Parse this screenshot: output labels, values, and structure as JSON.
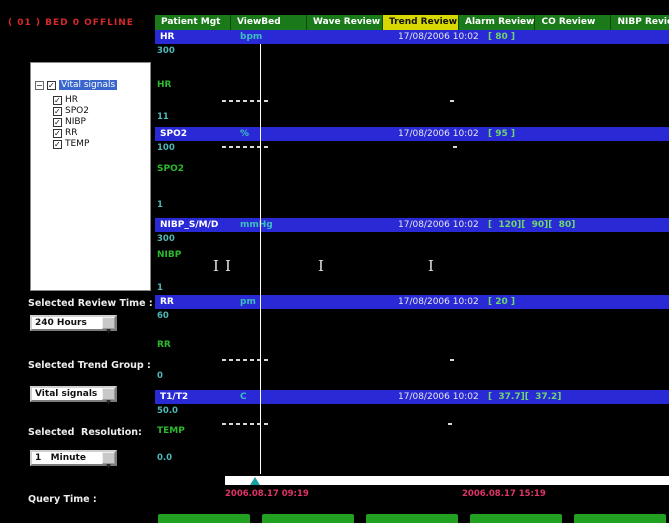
{
  "status_bar": {
    "text": "( 01 ) BED 0 OFFLINE"
  },
  "tabs": [
    {
      "label": "Patient Mgt"
    },
    {
      "label": "ViewBed"
    },
    {
      "label": "Wave Review"
    },
    {
      "label": "Trend Review",
      "active": true
    },
    {
      "label": "Alarm Review"
    },
    {
      "label": "CO Review"
    },
    {
      "label": "NIBP Review"
    }
  ],
  "tree": {
    "root_label": "Vital signals",
    "items": [
      {
        "label": "HR",
        "checked": true
      },
      {
        "label": "SPO2",
        "checked": true
      },
      {
        "label": "NIBP",
        "checked": true
      },
      {
        "label": "RR",
        "checked": true
      },
      {
        "label": "TEMP",
        "checked": true
      }
    ]
  },
  "controls": {
    "review_time": {
      "label": "Selected Review Time :",
      "value": "240 Hours"
    },
    "trend_group": {
      "label": "Selected Trend Group :",
      "value": "Vital signals"
    },
    "resolution": {
      "label": "Selected  Resolution:",
      "value": "1   Minute"
    },
    "query_time_label": "Query Time :"
  },
  "rows": [
    {
      "name": "HR",
      "unit": "bpm",
      "time": "17/08/2006 10:02",
      "values": "[ 80 ]",
      "scale_top": "300",
      "scale_bottom": "11",
      "trace_label": "HR"
    },
    {
      "name": "SPO2",
      "unit": "%",
      "time": "17/08/2006 10:02",
      "values": "[ 95 ]",
      "scale_top": "100",
      "scale_bottom": "1",
      "trace_label": "SPO2"
    },
    {
      "name": "NIBP_S/M/D",
      "unit": "mmHg",
      "time": "17/08/2006 10:02",
      "values": "[  120][  90][  80]",
      "scale_top": "300",
      "scale_bottom": "1",
      "trace_label": "NIBP"
    },
    {
      "name": "RR",
      "unit": "pm",
      "time": "17/08/2006 10:02",
      "values": "[ 20 ]",
      "scale_top": "60",
      "scale_bottom": "0",
      "trace_label": "RR"
    },
    {
      "name": "T1/T2",
      "unit": "C",
      "time": "17/08/2006 10:02",
      "values": "[  37.7][  37.2]",
      "scale_top": "50.0",
      "scale_bottom": "0.0",
      "trace_label": "TEMP"
    }
  ],
  "timeline": {
    "start_time": "2006.08.17 09:19",
    "end_time": "2006.08.17 15:19"
  },
  "icons": {
    "check": "✓",
    "dropdown_arrow": "▼",
    "expander_collapse": "−",
    "nibp_marker": "I"
  },
  "colors": {
    "header_bar": "#2929d6",
    "active_tab": "#d8d800",
    "tab_green": "#1a7a1a",
    "alarm_red": "#d42a2a",
    "label_green": "#2eb82e",
    "scale_cyan": "#4fb8b8",
    "query_time_pink": "#e03366"
  },
  "chart_data": {
    "type": "line",
    "cursor_time": "17/08/2006 10:02",
    "x_range": [
      "2006.08.17 09:19",
      "2006.08.17 15:19"
    ],
    "series": [
      {
        "name": "HR",
        "unit": "bpm",
        "value_at_cursor": 80,
        "ylim": [
          11,
          300
        ]
      },
      {
        "name": "SPO2",
        "unit": "%",
        "value_at_cursor": 95,
        "ylim": [
          1,
          100
        ]
      },
      {
        "name": "NIBP_S/M/D",
        "unit": "mmHg",
        "value_at_cursor": [
          120,
          90,
          80
        ],
        "ylim": [
          1,
          300
        ]
      },
      {
        "name": "RR",
        "unit": "pm",
        "value_at_cursor": 20,
        "ylim": [
          0,
          60
        ]
      },
      {
        "name": "T1/T2",
        "unit": "C",
        "value_at_cursor": [
          37.7,
          37.2
        ],
        "ylim": [
          0.0,
          50.0
        ]
      }
    ]
  }
}
